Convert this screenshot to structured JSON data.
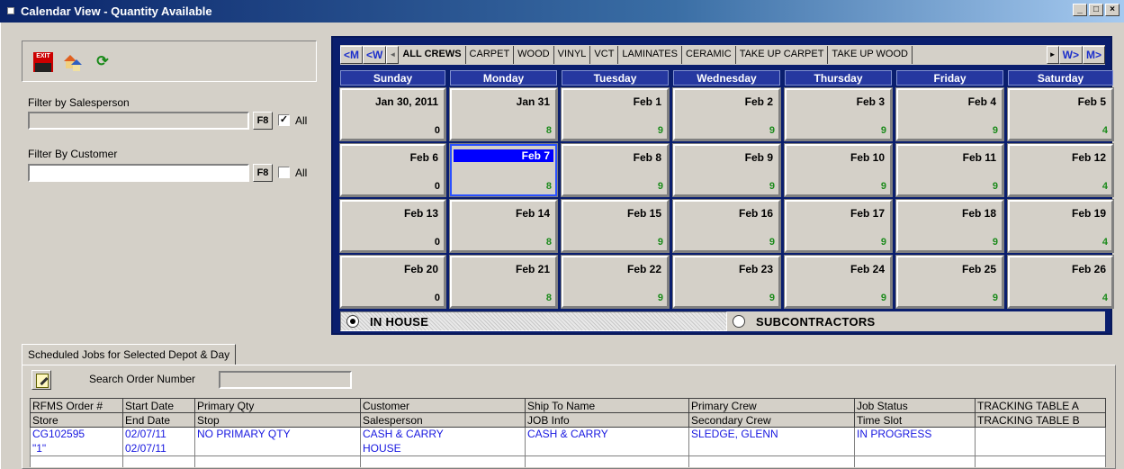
{
  "window": {
    "title": "Calendar View - Quantity Available"
  },
  "toolbar": {
    "exit_label": "EXIT"
  },
  "filters": {
    "salesperson_label": "Filter by Salesperson",
    "salesperson_value": "",
    "salesperson_f8": "F8",
    "salesperson_all_label": "All",
    "salesperson_all_checked": "✓",
    "customer_label": "Filter By Customer",
    "customer_value": "",
    "customer_f8": "F8",
    "customer_all_label": "All",
    "customer_all_checked": ""
  },
  "calendar": {
    "nav": {
      "prev_month": "<M",
      "prev_week": "<W",
      "next_week": "W>",
      "next_month": "M>"
    },
    "tabs": [
      "ALL CREWS",
      "CARPET",
      "WOOD",
      "VINYL",
      "VCT",
      "LAMINATES",
      "CERAMIC",
      "TAKE UP CARPET",
      "TAKE UP WOOD"
    ],
    "active_tab": "ALL CREWS",
    "days": [
      "Sunday",
      "Monday",
      "Tuesday",
      "Wednesday",
      "Thursday",
      "Friday",
      "Saturday"
    ],
    "weeks": [
      [
        {
          "d": "Jan 30, 2011",
          "q": "0"
        },
        {
          "d": "Jan 31",
          "q": "8"
        },
        {
          "d": "Feb 1",
          "q": "9"
        },
        {
          "d": "Feb 2",
          "q": "9"
        },
        {
          "d": "Feb 3",
          "q": "9"
        },
        {
          "d": "Feb 4",
          "q": "9"
        },
        {
          "d": "Feb 5",
          "q": "4"
        }
      ],
      [
        {
          "d": "Feb 6",
          "q": "0"
        },
        {
          "d": "Feb 7",
          "q": "8",
          "selected": true
        },
        {
          "d": "Feb 8",
          "q": "9"
        },
        {
          "d": "Feb 9",
          "q": "9"
        },
        {
          "d": "Feb 10",
          "q": "9"
        },
        {
          "d": "Feb 11",
          "q": "9"
        },
        {
          "d": "Feb 12",
          "q": "4"
        }
      ],
      [
        {
          "d": "Feb 13",
          "q": "0"
        },
        {
          "d": "Feb 14",
          "q": "8"
        },
        {
          "d": "Feb 15",
          "q": "9"
        },
        {
          "d": "Feb 16",
          "q": "9"
        },
        {
          "d": "Feb 17",
          "q": "9"
        },
        {
          "d": "Feb 18",
          "q": "9"
        },
        {
          "d": "Feb 19",
          "q": "4"
        }
      ],
      [
        {
          "d": "Feb 20",
          "q": "0"
        },
        {
          "d": "Feb 21",
          "q": "8"
        },
        {
          "d": "Feb 22",
          "q": "9"
        },
        {
          "d": "Feb 23",
          "q": "9"
        },
        {
          "d": "Feb 24",
          "q": "9"
        },
        {
          "d": "Feb 25",
          "q": "9"
        },
        {
          "d": "Feb 26",
          "q": "4"
        }
      ]
    ],
    "in_house_label": "IN HOUSE",
    "subcontractors_label": "SUBCONTRACTORS",
    "selected_option": "IN HOUSE"
  },
  "jobs": {
    "tab_label": "Scheduled Jobs for Selected Depot & Day",
    "search_label": "Search Order Number",
    "search_value": "",
    "headers_row1": [
      "RFMS Order #",
      "Start Date",
      "Primary Qty",
      "Customer",
      "Ship To Name",
      "Primary Crew",
      "Job Status",
      "TRACKING TABLE A"
    ],
    "headers_row2": [
      "Store",
      "End Date",
      "Stop",
      "Salesperson",
      "JOB Info",
      "Secondary Crew",
      "Time Slot",
      "TRACKING TABLE B"
    ],
    "rows": [
      {
        "line1": [
          "CG102595",
          "02/07/11",
          "NO PRIMARY QTY",
          "CASH & CARRY",
          "CASH & CARRY",
          "SLEDGE, GLENN",
          "IN PROGRESS",
          ""
        ],
        "line2": [
          "\"1\"",
          "02/07/11",
          "",
          "HOUSE",
          "",
          "",
          "",
          ""
        ]
      }
    ]
  }
}
